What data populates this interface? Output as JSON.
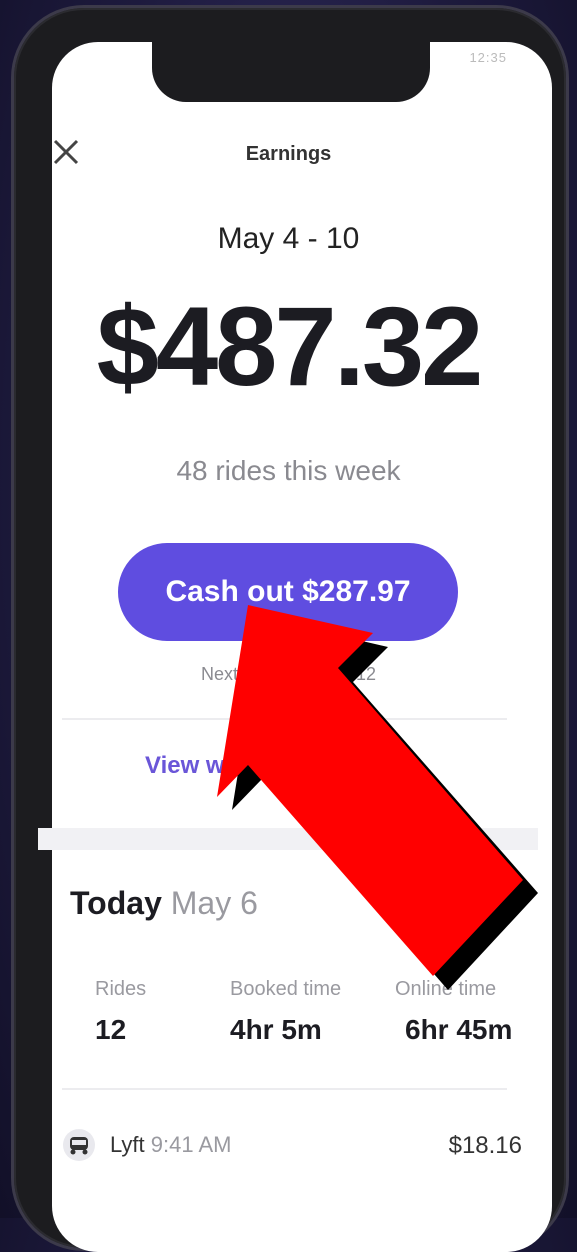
{
  "status_bar": {
    "text": "12:35"
  },
  "header": {
    "title": "Earnings",
    "close_icon": "close-icon"
  },
  "summary": {
    "date_range": "May 4 - 10",
    "total": "$487.32",
    "rides_text": "48 rides this week"
  },
  "cashout": {
    "label": "Cash out $287.97"
  },
  "next_payment": {
    "text": "Next payment May 12"
  },
  "weekly_link": {
    "label": "View weekly summary"
  },
  "today": {
    "label": "Today",
    "date": "May 6",
    "stats": [
      {
        "label": "Rides",
        "value": "12"
      },
      {
        "label": "Booked time",
        "value": "4hr 5m"
      },
      {
        "label": "Online time",
        "value": "6hr 45m"
      }
    ]
  },
  "rides": [
    {
      "provider": "Lyft",
      "time": "9:41 AM",
      "amount": "$18.16",
      "icon": "car-icon"
    }
  ],
  "colors": {
    "accent": "#5f4de0",
    "arrow": "#ff0000"
  }
}
